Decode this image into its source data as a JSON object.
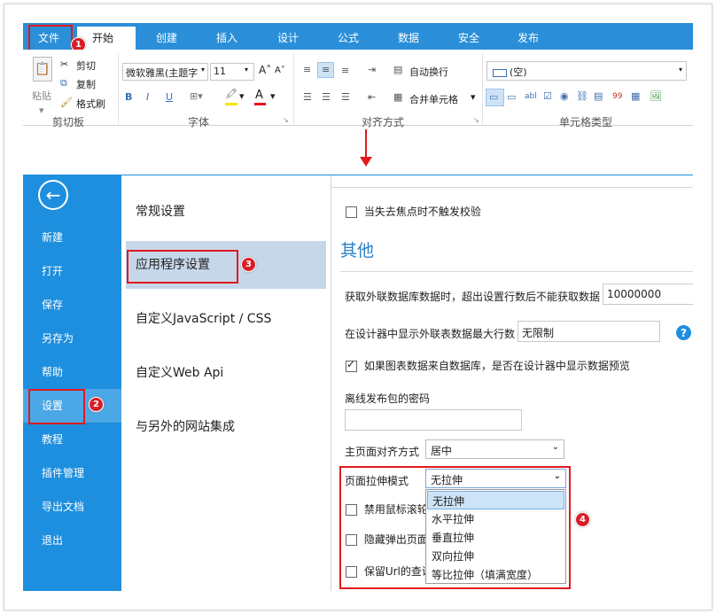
{
  "ribbon": {
    "tabs": [
      "文件",
      "开始",
      "创建",
      "插入",
      "设计",
      "公式",
      "数据",
      "安全",
      "发布"
    ],
    "clipboard": {
      "paste": "粘贴",
      "cut": "剪切",
      "copy": "复制",
      "format_painter": "格式刷",
      "label": "剪切板"
    },
    "font": {
      "name": "微软雅黑(主题字",
      "size": "11",
      "label": "字体"
    },
    "alignment": {
      "wrap": "自动换行",
      "merge": "合并单元格",
      "label": "对齐方式"
    },
    "cell_type": {
      "value": "(空)",
      "label": "单元格类型"
    }
  },
  "backstage": {
    "nav": [
      "新建",
      "打开",
      "保存",
      "另存为",
      "帮助",
      "设置",
      "教程",
      "插件管理",
      "导出文档",
      "退出"
    ],
    "middle": [
      "常规设置",
      "应用程序设置",
      "自定义JavaScript / CSS",
      "自定义Web Api",
      "与另外的网站集成"
    ],
    "content": {
      "top_checkbox": "当失去焦点时不触发校验",
      "section_title": "其他",
      "ext_db_label": "获取外联数据库数据时，超出设置行数后不能获取数据",
      "ext_db_value": "10000000",
      "designer_rows_label": "在设计器中显示外联表数据最大行数",
      "designer_rows_value": "无限制",
      "help": "?",
      "preview_checkbox": "如果图表数据来自数据库，是否在设计器中显示数据预览",
      "offline_pwd_label": "离线发布包的密码",
      "offline_pwd_value": "",
      "align_label": "主页面对齐方式",
      "align_value": "居中",
      "stretch_label": "页面拉伸模式",
      "stretch_value": "无拉伸",
      "cb1": "禁用鼠标滚轮",
      "cb2": "隐藏弹出页面",
      "cb3": "保留Url的查询",
      "dropdown": [
        "无拉伸",
        "水平拉伸",
        "垂直拉伸",
        "双向拉伸",
        "等比拉伸（填满宽度）"
      ]
    }
  },
  "badges": [
    "1",
    "2",
    "3",
    "4"
  ],
  "colors": {
    "ribbon": "#2a8fd8",
    "nav": "#1e8fde",
    "highlight": "#e1191e",
    "selected_mid": "#c7d7ea"
  }
}
